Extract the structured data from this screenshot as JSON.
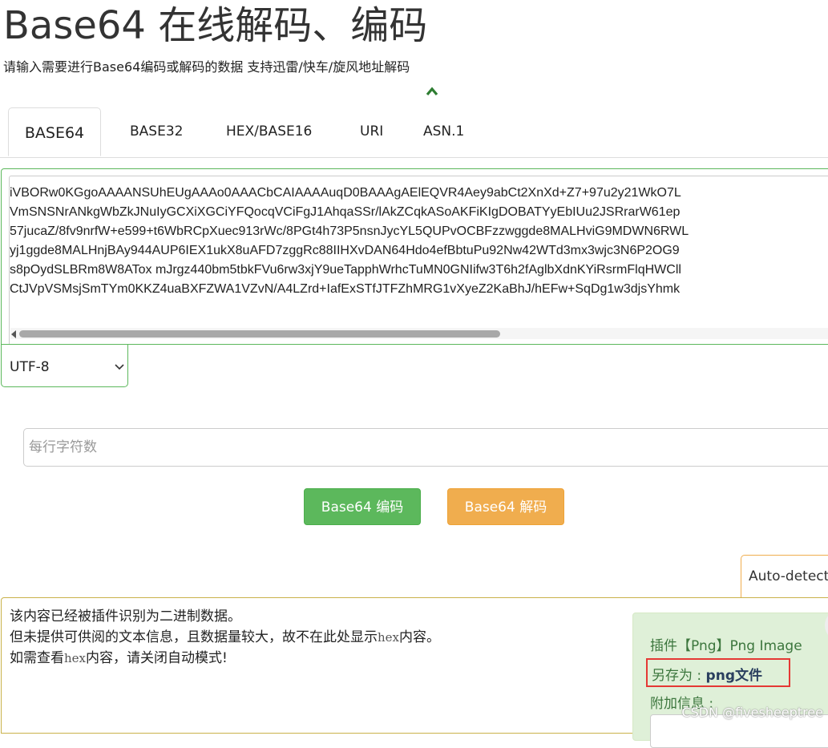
{
  "page": {
    "title": "Base64 在线解码、编码",
    "subtitle": "请输入需要进行Base64编码或解码的数据 支持迅雷/快车/旋风地址解码"
  },
  "tabs": [
    {
      "label": "BASE64",
      "active": true
    },
    {
      "label": "BASE32",
      "active": false
    },
    {
      "label": "HEX/BASE16",
      "active": false
    },
    {
      "label": "URI",
      "active": false
    },
    {
      "label": "ASN.1",
      "active": false
    }
  ],
  "input": {
    "lines": [
      "iVBORw0KGgoAAAANSUhEUgAAAo0AAACbCAIAAAAuqD0BAAAgAElEQVR4Aey9abCt2XnXd+Z7+97u2y21WkO7L",
      "VmSNSNrANkgWbZkJNuIyGCXiXGCiYFQocqVCiFgJ1AhqaSSr/lAkZCqkASoAKFiKIgDOBATYyEbIUu2JSRrarW61ep",
      "57jucaZ/8fv9nrfW+e599+t6WbRCpXuec913rWc/8PGt4h73P5nsnJycYL5QUPvOCBFzzwggde8MALHviG9MDWN6RWL",
      "yj1ggde8MALHnjBAy944AUP6IEX1ukX8uAFD7zggRc88IIHXvDAN64Hdo4efBbtuPu92Nw42WTd3mx3wjc3N6P2OG9",
      "s8pOydSLBRm8W8ATox mJrgz440bm5tbkFVu6rw3xjY9ueTapphWrhcTuMN0GNIifw3T6h2fAglbXdnKYiRsrmFlqHWCll",
      "CtJVpVSMsjSmTYm0KKZ4uaBXFZWA1VZvN/A4LZrd+IafExSTfJTFZhMRG1vXyeZ2KaBhJ/hEFw+SqDg1w3djsYhmk"
    ],
    "encoding": "UTF-8",
    "line_chars_placeholder": "每行字符数"
  },
  "buttons": {
    "encode": "Base64 编码",
    "decode": "Base64 解码"
  },
  "mode": {
    "value": "Auto-detect"
  },
  "output": {
    "line1": "该内容已经被插件识别为二进制数据。",
    "line2a": "但未提供可供阅的文本信息，且数据量较大，故不在此处显示",
    "line2_mono": "hex",
    "line2b": "内容。",
    "line3a": "如需查看",
    "line3_mono": "hex",
    "line3b": "内容，请关闭自动模式!"
  },
  "plugin": {
    "title": "插件【Png】Png Image",
    "save_as_label": "另存为 : ",
    "save_as_link": "png文件",
    "extra_label": "附加信息 :"
  },
  "watermark": "CSDN @fivesheeptree",
  "colors": {
    "success": "#5cb85c",
    "warning": "#f0ad4e",
    "highlight_red": "#e53935",
    "plugin_bg": "#dff0d8",
    "plugin_text": "#3c763d"
  }
}
